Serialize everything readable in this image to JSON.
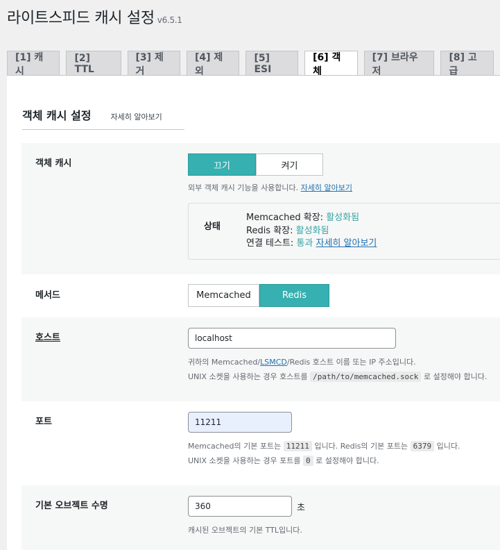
{
  "header": {
    "title": "라이트스피드 캐시 설정",
    "version": "v6.5.1"
  },
  "tabs": [
    {
      "label": "[1] 캐시",
      "active": false
    },
    {
      "label": "[2] TTL",
      "active": false
    },
    {
      "label": "[3] 제거",
      "active": false
    },
    {
      "label": "[4] 제외",
      "active": false
    },
    {
      "label": "[5] ESI",
      "active": false
    },
    {
      "label": "[6] 객체",
      "active": true
    },
    {
      "label": "[7] 브라우저",
      "active": false
    },
    {
      "label": "[8] 고급",
      "active": false
    }
  ],
  "section": {
    "title": "객체 캐시 설정",
    "learn_more": "자세히 알아보기"
  },
  "object_cache": {
    "label": "객체 캐시",
    "off_label": "끄기",
    "on_label": "켜기",
    "selected": "끄기",
    "desc": "외부 객체 캐시 기능을 사용합니다.",
    "desc_link": "자세히 알아보기",
    "status": {
      "label": "상태",
      "memcached_label": "Memcached 확장:",
      "memcached_value": "활성화됨",
      "redis_label": "Redis 확장:",
      "redis_value": "활성화됨",
      "conn_label": "연결 테스트:",
      "conn_value": "통과",
      "conn_link": "자세히 알아보기"
    }
  },
  "method": {
    "label": "메서드",
    "memcached_label": "Memcached",
    "redis_label": "Redis",
    "selected": "Redis"
  },
  "host": {
    "label": "호스트",
    "value": "localhost",
    "desc1_a": "귀하의 Memcached/",
    "desc1_link": "LSMCD",
    "desc1_b": "/Redis 호스트 이름 또는 IP 주소입니다.",
    "desc2_a": "UNIX 소켓을 사용하는 경우 호스트를",
    "desc2_code": "/path/to/memcached.sock",
    "desc2_b": "로 설정해야 합니다."
  },
  "port": {
    "label": "포트",
    "value": "11211",
    "desc1_a": "Memcached의 기본 포트는",
    "desc1_code1": "11211",
    "desc1_b": "입니다. Redis의 기본 포트는",
    "desc1_code2": "6379",
    "desc1_c": "입니다.",
    "desc2_a": "UNIX 소켓을 사용하는 경우 포트를",
    "desc2_code": "0",
    "desc2_b": "로 설정해야 합니다."
  },
  "ttl": {
    "label": "기본 오브젝트 수명",
    "value": "360",
    "unit": "초",
    "desc": "캐시된 오브젝트의 기본 TTL입니다."
  }
}
